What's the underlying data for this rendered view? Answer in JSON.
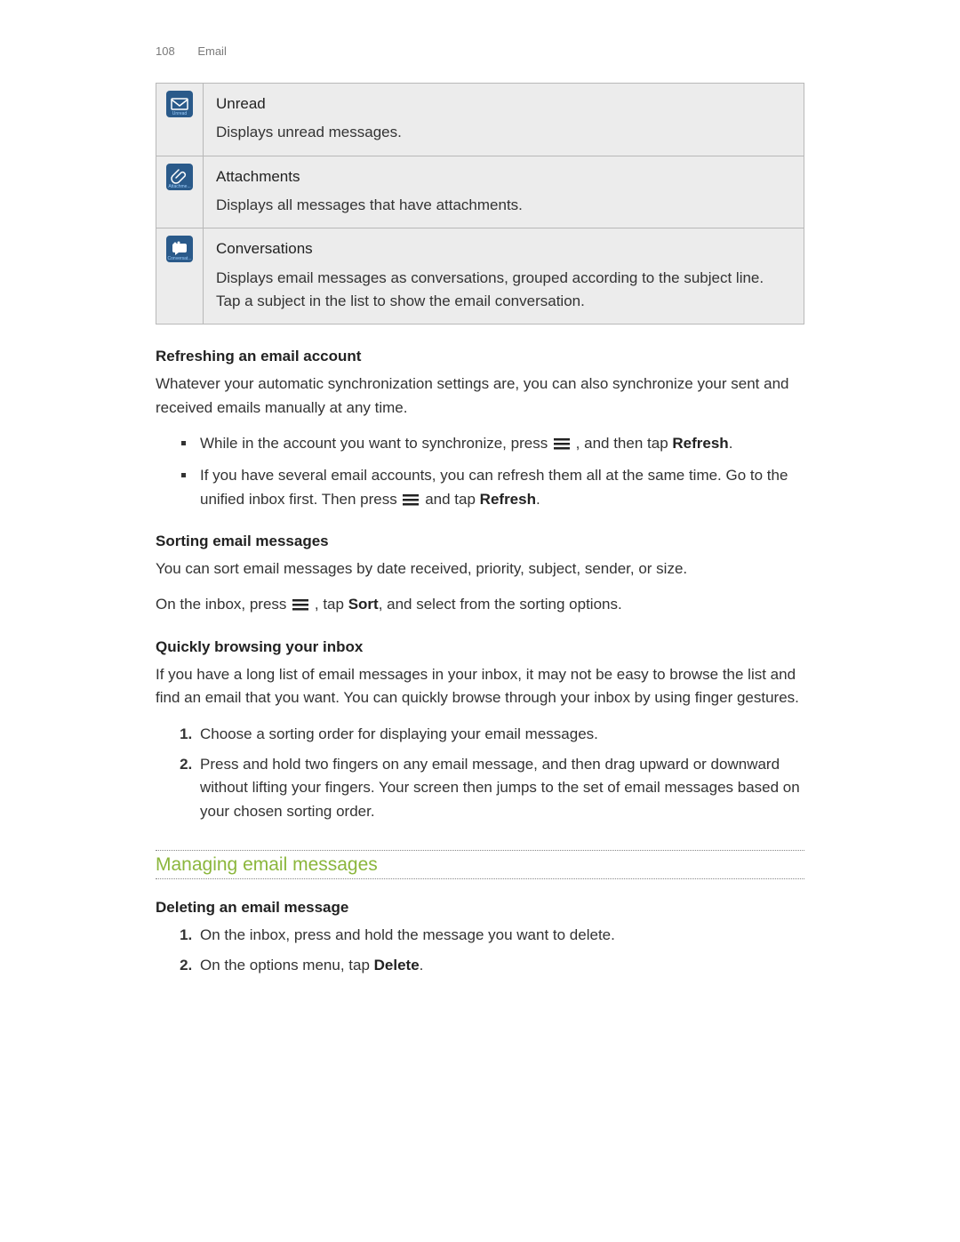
{
  "header": {
    "page_number": "108",
    "section": "Email"
  },
  "views": [
    {
      "title": "Unread",
      "desc": "Displays unread messages.",
      "icon": "envelope-icon",
      "caption": "Unread"
    },
    {
      "title": "Attachments",
      "desc": "Displays all messages that have attachments.",
      "icon": "paperclip-icon",
      "caption": "Attachme..."
    },
    {
      "title": "Conversations",
      "desc": "Displays email messages as conversations, grouped according to the subject line. Tap a subject in the list to show the email conversation.",
      "icon": "speech-bubble-icon",
      "caption": "Conversat..."
    }
  ],
  "refresh": {
    "heading": "Refreshing an email account",
    "intro": "Whatever your automatic synchronization settings are, you can also synchronize your sent and received emails manually at any time.",
    "bullets": {
      "b1_pre": "While in the account you want to synchronize, press ",
      "b1_mid": ", and then tap ",
      "b1_bold": "Refresh",
      "b1_end": ".",
      "b2_pre": "If you have several email accounts, you can refresh them all at the same time. Go to the unified inbox first. Then press ",
      "b2_mid": " and tap ",
      "b2_bold": "Refresh",
      "b2_end": "."
    }
  },
  "sorting": {
    "heading": "Sorting email messages",
    "intro": "You can sort email messages by date received, priority, subject, sender, or size.",
    "line_pre": "On the inbox, press ",
    "line_mid": ", tap ",
    "line_bold": "Sort",
    "line_end": ", and select from the sorting options."
  },
  "browsing": {
    "heading": "Quickly browsing your inbox",
    "intro": "If you have a long list of email messages in your inbox, it may not be easy to browse the list and find an email that you want. You can quickly browse through your inbox by using finger gestures.",
    "steps": [
      "Choose a sorting order for displaying your email messages.",
      "Press and hold two fingers on any email message, and then drag upward or downward without lifting your fingers. Your screen then jumps to the set of email messages based on your chosen sorting order."
    ]
  },
  "managing": {
    "section_title": "Managing email messages",
    "deleting": {
      "heading": "Deleting an email message",
      "steps_1": "On the inbox, press and hold the message you want to delete.",
      "steps_2_pre": "On the options menu, tap ",
      "steps_2_bold": "Delete",
      "steps_2_end": "."
    }
  }
}
